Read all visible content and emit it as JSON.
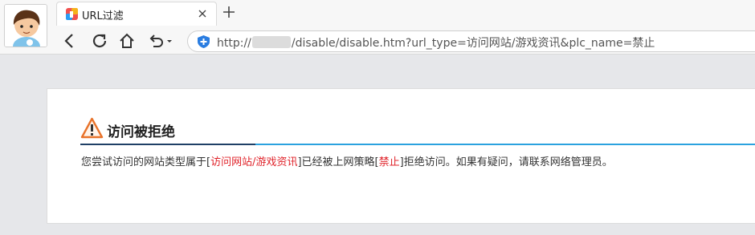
{
  "browser": {
    "tab_title": "URL过滤",
    "url": {
      "prefix": "http://",
      "suffix": "/disable/disable.htm?url_type=访问网站/游戏资讯&plc_name=禁止"
    }
  },
  "page": {
    "heading": "访问被拒绝",
    "message": {
      "part1": "您尝试访问的网站类型属于[",
      "category": "访问网站/游戏资讯",
      "part2": "]已经被上网策略[",
      "policy": "禁止",
      "part3": "]拒绝访问。如果有疑问，请联系网络管理员。"
    }
  },
  "colors": {
    "alert_red": "#e0242b",
    "rule_dark": "#1f3f66",
    "rule_light": "#2ba2df",
    "warning_orange": "#e8722a"
  }
}
